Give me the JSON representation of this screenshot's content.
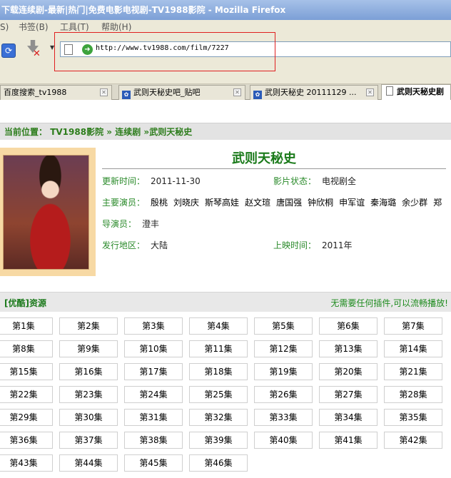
{
  "window": {
    "title": "下载连续剧-最新|热门|免费电影电视剧-TV1988影院 - Mozilla Firefox"
  },
  "menu": {
    "items": [
      "S)",
      "书签(B)",
      "工具(T)",
      "帮助(H)"
    ]
  },
  "toolbar": {
    "url": "http://www.tv1988.com/film/7227"
  },
  "tabs": [
    {
      "label": "百度搜索_tv1988"
    },
    {
      "label": "武则天秘史吧_贴吧"
    },
    {
      "label": "武则天秘史 20111129 ..."
    },
    {
      "label": "武则天秘史剧"
    }
  ],
  "breadcrumb": {
    "label": "当前位置：",
    "site": "TV1988影院",
    "sep1": "»",
    "category": "连续剧",
    "sep2": "»",
    "current": "武则天秘史"
  },
  "film": {
    "title": "武则天秘史",
    "update_label": "更新时间：",
    "update_value": "2011-11-30",
    "status_label": "影片状态：",
    "status_value": "电视剧全",
    "actors_label": "主要演员：",
    "actors": [
      "殷桃",
      "刘晓庆",
      "斯琴高娃",
      "赵文瑄",
      "唐国强",
      "钟欣桐",
      "申军谊",
      "秦海璐",
      "余少群",
      "郑"
    ],
    "director_label": "导演员：",
    "director_value": "澄丰",
    "region_label": "发行地区：",
    "region_value": "大陆",
    "release_label": "上映时间：",
    "release_value": "2011年"
  },
  "resource": {
    "title": "[优酷]资源",
    "note": "无需要任何插件,可以流畅播放!"
  },
  "episodes": [
    "第1集",
    "第2集",
    "第3集",
    "第4集",
    "第5集",
    "第6集",
    "第7集",
    "第8集",
    "第9集",
    "第10集",
    "第11集",
    "第12集",
    "第13集",
    "第14集",
    "第15集",
    "第16集",
    "第17集",
    "第18集",
    "第19集",
    "第20集",
    "第21集",
    "第22集",
    "第23集",
    "第24集",
    "第25集",
    "第26集",
    "第27集",
    "第28集",
    "第29集",
    "第30集",
    "第31集",
    "第32集",
    "第33集",
    "第34集",
    "第35集",
    "第36集",
    "第37集",
    "第38集",
    "第39集",
    "第40集",
    "第41集",
    "第42集",
    "第43集",
    "第44集",
    "第45集",
    "第46集"
  ]
}
